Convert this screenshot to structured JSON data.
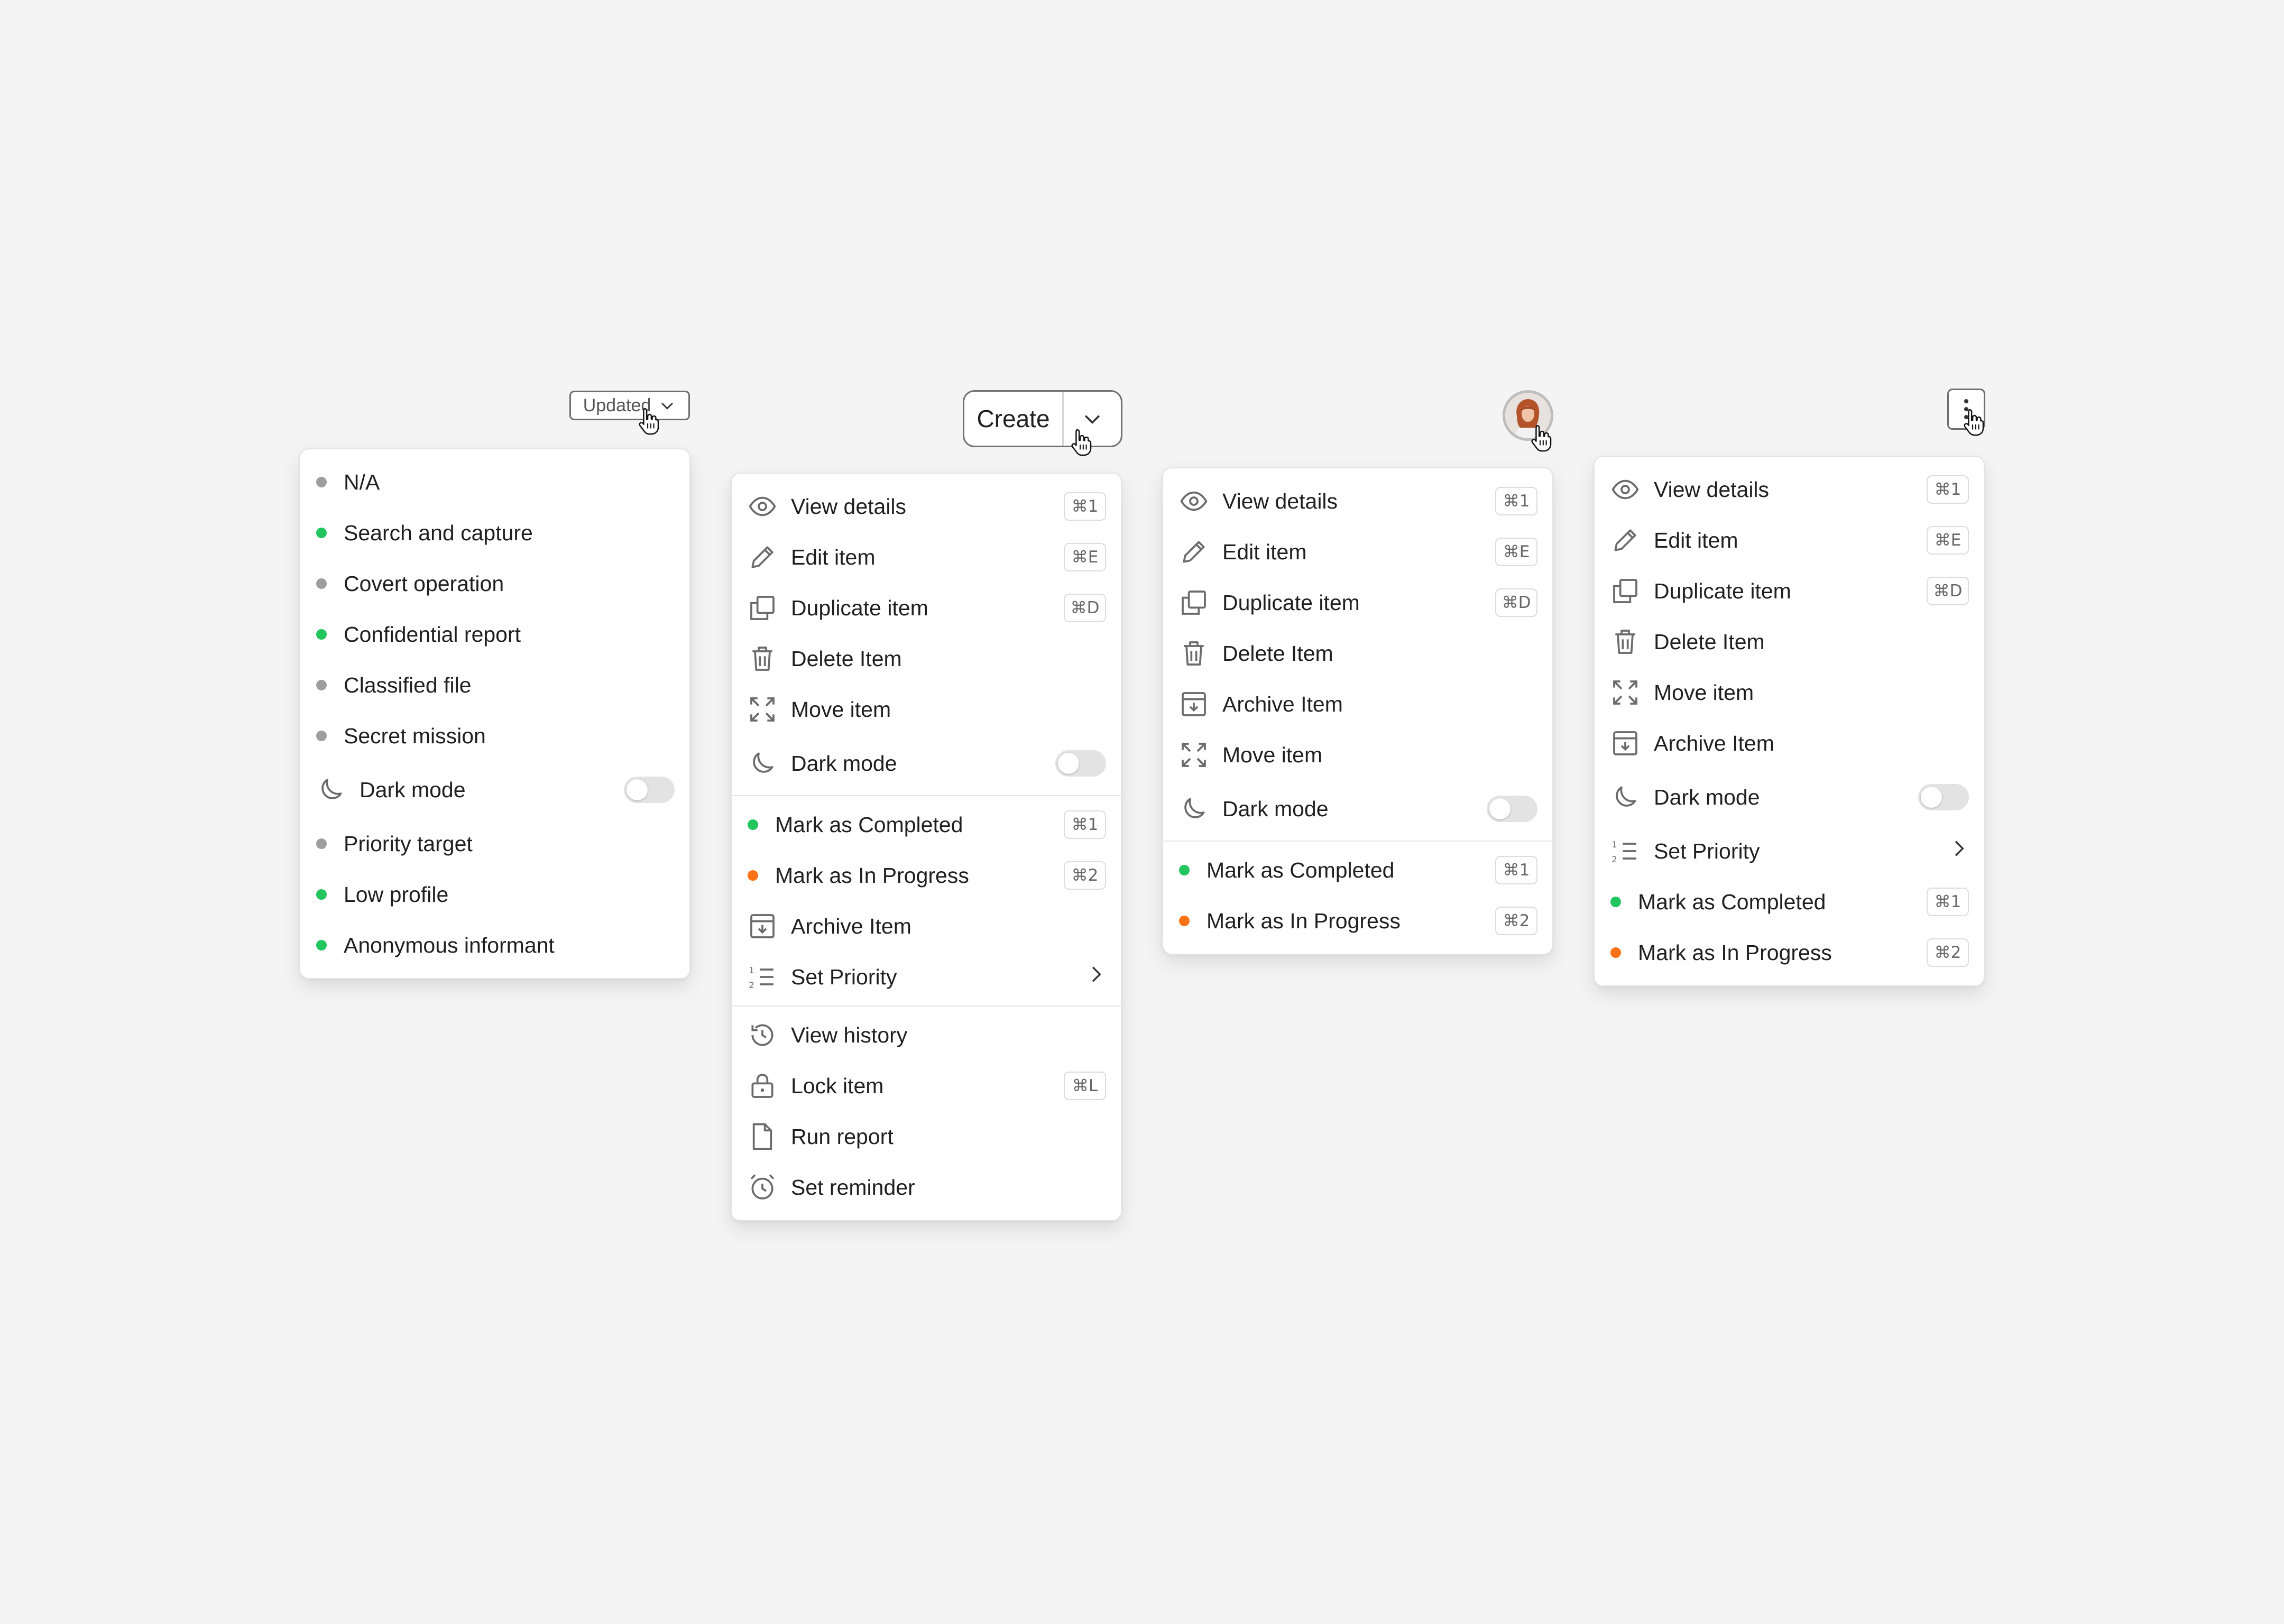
{
  "colors": {
    "dot_green": "#22c55e",
    "dot_gray": "#9e9e9e",
    "dot_orange": "#f97316",
    "toggle_off": "#e3e3e3"
  },
  "triggers": {
    "updated_label": "Updated",
    "create_label": "Create"
  },
  "status_menu": {
    "items": [
      {
        "label": "N/A",
        "dot": "gray"
      },
      {
        "label": "Search and capture",
        "dot": "green"
      },
      {
        "label": "Covert operation",
        "dot": "gray"
      },
      {
        "label": "Confidential report",
        "dot": "green"
      },
      {
        "label": "Classified file",
        "dot": "gray"
      },
      {
        "label": "Secret mission",
        "dot": "gray"
      }
    ],
    "dark_mode": {
      "label": "Dark mode",
      "icon": "moon-icon",
      "on": false
    },
    "items_after": [
      {
        "label": "Priority target",
        "dot": "gray"
      },
      {
        "label": "Low profile",
        "dot": "green"
      },
      {
        "label": "Anonymous informant",
        "dot": "green"
      }
    ]
  },
  "create_menu": {
    "view_details": {
      "label": "View details",
      "shortcut": "⌘1",
      "icon": "eye-icon"
    },
    "edit_item": {
      "label": "Edit item",
      "shortcut": "⌘E",
      "icon": "pencil-icon"
    },
    "duplicate_item": {
      "label": "Duplicate item",
      "shortcut": "⌘D",
      "icon": "duplicate-icon"
    },
    "delete_item": {
      "label": "Delete Item",
      "icon": "trash-icon"
    },
    "move_item": {
      "label": "Move item",
      "icon": "move-icon"
    },
    "dark_mode": {
      "label": "Dark mode",
      "icon": "moon-icon",
      "on": false
    },
    "mark_completed": {
      "label": "Mark as Completed",
      "shortcut": "⌘1",
      "dot": "green"
    },
    "mark_in_progress": {
      "label": "Mark as In Progress",
      "shortcut": "⌘2",
      "dot": "orange"
    },
    "archive_item": {
      "label": "Archive Item",
      "icon": "archive-icon"
    },
    "set_priority": {
      "label": "Set Priority",
      "icon": "priority-list-icon"
    },
    "view_history": {
      "label": "View history",
      "icon": "history-icon"
    },
    "lock_item": {
      "label": "Lock item",
      "shortcut": "⌘L",
      "icon": "lock-icon"
    },
    "run_report": {
      "label": "Run report",
      "icon": "file-icon"
    },
    "set_reminder": {
      "label": "Set reminder",
      "icon": "alarm-clock-icon"
    }
  },
  "avatar_menu": {
    "view_details": {
      "label": "View details",
      "shortcut": "⌘1"
    },
    "edit_item": {
      "label": "Edit item",
      "shortcut": "⌘E"
    },
    "duplicate_item": {
      "label": "Duplicate item",
      "shortcut": "⌘D"
    },
    "delete_item": {
      "label": "Delete Item"
    },
    "archive_item": {
      "label": "Archive Item"
    },
    "move_item": {
      "label": "Move item"
    },
    "dark_mode": {
      "label": "Dark mode",
      "on": false
    },
    "mark_completed": {
      "label": "Mark as Completed",
      "shortcut": "⌘1"
    },
    "mark_in_progress": {
      "label": "Mark as In Progress",
      "shortcut": "⌘2"
    }
  },
  "kebab_menu": {
    "view_details": {
      "label": "View details",
      "shortcut": "⌘1"
    },
    "edit_item": {
      "label": "Edit item",
      "shortcut": "⌘E"
    },
    "duplicate_item": {
      "label": "Duplicate item",
      "shortcut": "⌘D"
    },
    "delete_item": {
      "label": "Delete Item"
    },
    "move_item": {
      "label": "Move item"
    },
    "archive_item": {
      "label": "Archive Item"
    },
    "dark_mode": {
      "label": "Dark mode",
      "on": false
    },
    "set_priority": {
      "label": "Set Priority"
    },
    "mark_completed": {
      "label": "Mark as Completed",
      "shortcut": "⌘1"
    },
    "mark_in_progress": {
      "label": "Mark as In Progress",
      "shortcut": "⌘2"
    }
  }
}
